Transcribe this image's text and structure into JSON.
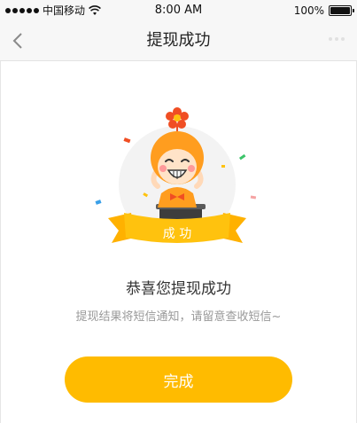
{
  "status_bar": {
    "carrier": "中国移动",
    "time": "8:00 AM",
    "battery": "100%"
  },
  "nav": {
    "title": "提现成功",
    "back_icon": "chevron-left-icon",
    "more_icon": "more-dots-icon"
  },
  "illustration": {
    "ribbon_text": "成 功",
    "colors": {
      "orange": "#ff9d1f",
      "yellow": "#ffc20e",
      "flower": "#f04e23"
    }
  },
  "result": {
    "title": "恭喜您提现成功",
    "description": "提现结果将短信通知，请留意查收短信~"
  },
  "actions": {
    "done_label": "完成"
  },
  "colors": {
    "accent": "#ffbb00",
    "background": "#ffffff",
    "nav_background": "#f7f7f7",
    "muted_text": "#999999"
  }
}
